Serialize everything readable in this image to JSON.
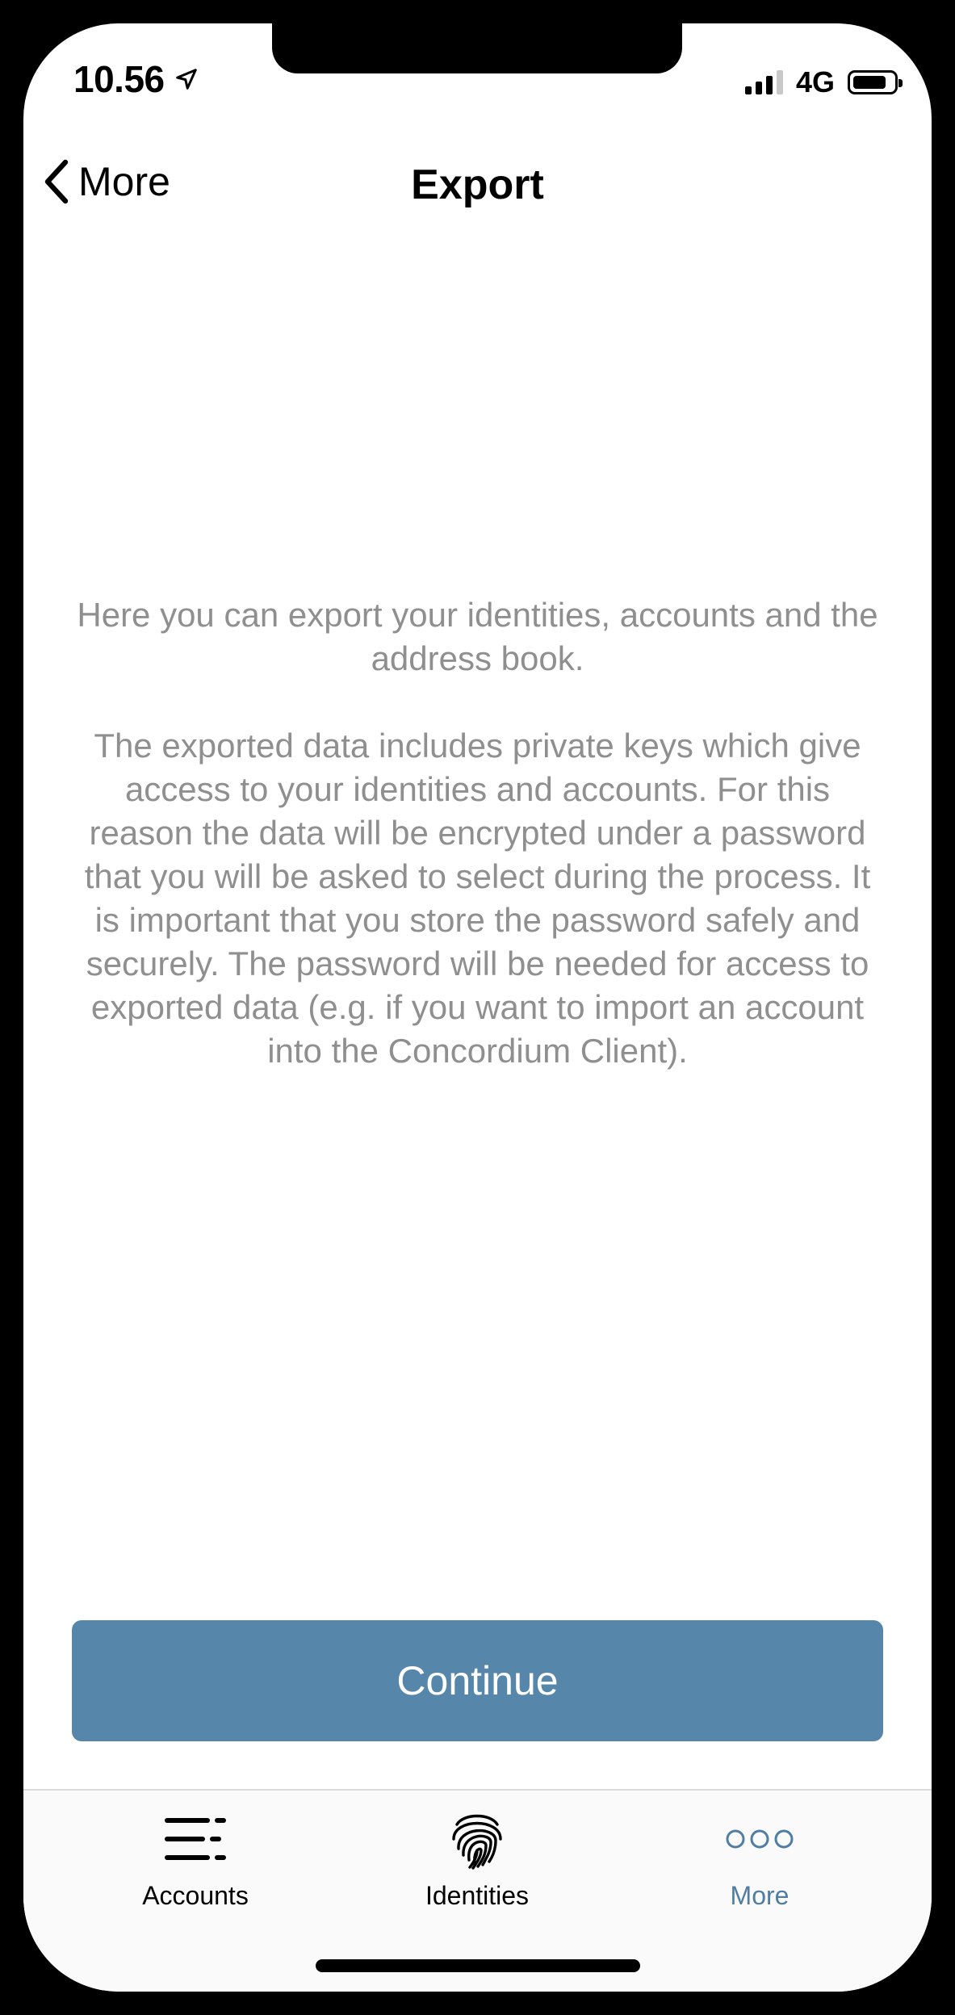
{
  "status_bar": {
    "time": "10.56",
    "network": "4G",
    "icons": [
      "location-arrow-icon",
      "cellular-signal-icon",
      "battery-icon"
    ]
  },
  "nav": {
    "back_label": "More",
    "title": "Export"
  },
  "content": {
    "intro": "Here you can export your identities, accounts and the address book.",
    "details": "The exported data includes private keys which give access to your identities and accounts. For this reason the data will be encrypted under a password that you will be asked to select during the process. It is important that you store the password safely and securely. The password will be needed for access to exported data (e.g. if you want to import an account into the Concordium Client)."
  },
  "actions": {
    "continue_label": "Continue"
  },
  "tabbar": {
    "tabs": [
      {
        "label": "Accounts",
        "icon": "accounts-list-icon",
        "active": false
      },
      {
        "label": "Identities",
        "icon": "fingerprint-icon",
        "active": false
      },
      {
        "label": "More",
        "icon": "more-circles-icon",
        "active": true
      }
    ]
  },
  "colors": {
    "accent": "#5686a9",
    "active_tab": "#4f7da3",
    "body_text": "#8f8f8f"
  }
}
